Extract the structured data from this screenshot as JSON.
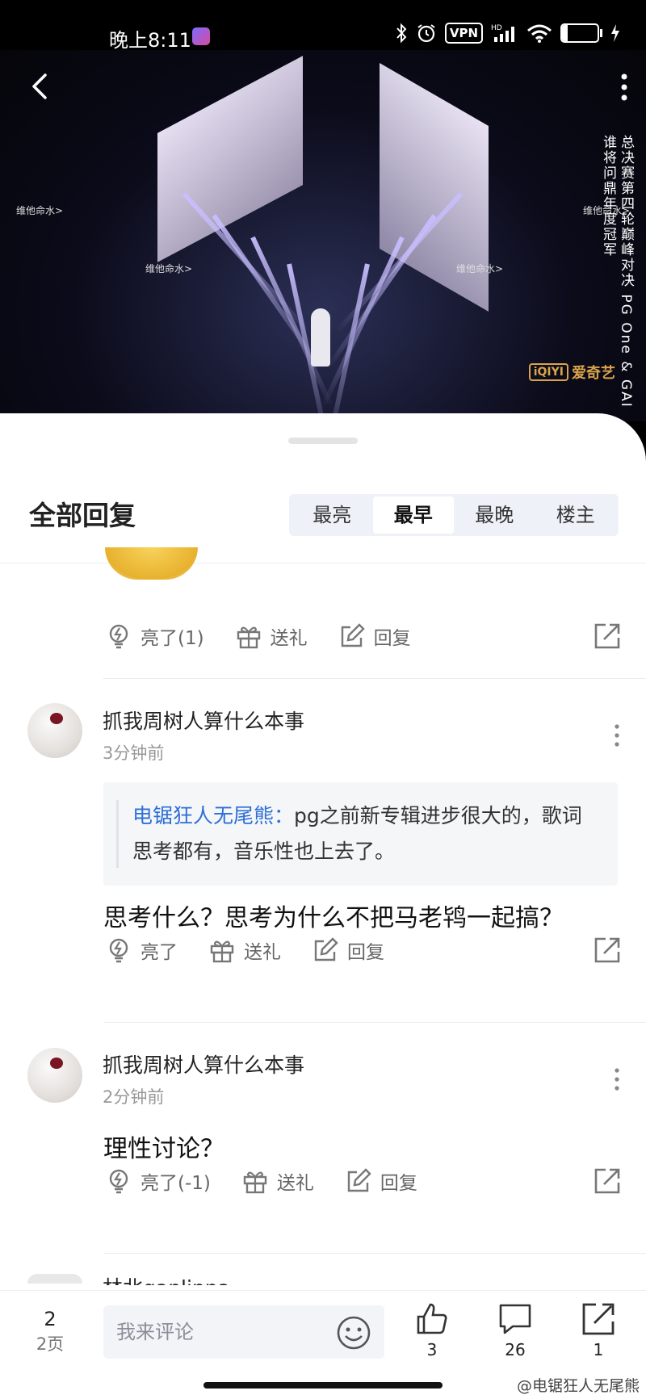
{
  "status_bar": {
    "time": "晚上8:11",
    "vpn": "VPN",
    "network": "HD",
    "battery": "17",
    "battery_level": 0.17
  },
  "video": {
    "overlay_title": "总决赛第四轮巅峰对决 PG One & GAI 谁将问鼎年度冠军",
    "captions": [
      "维他命水>",
      "维他命水>",
      "维他命水>",
      "维他命水>"
    ],
    "brand_badge": "iQIYI",
    "brand_name": "爱奇艺"
  },
  "sheet": {
    "title": "全部回复",
    "sort_tabs": [
      {
        "label": "最亮",
        "active": false
      },
      {
        "label": "最早",
        "active": true
      },
      {
        "label": "最晚",
        "active": false
      },
      {
        "label": "楼主",
        "active": false
      }
    ]
  },
  "top_actions": {
    "like": "亮了(1)",
    "gift": "送礼",
    "reply": "回复"
  },
  "comments": [
    {
      "username": "抓我周树人算什么本事",
      "time": "3分钟前",
      "quote_author": "电锯狂人无尾熊：",
      "quote_text": "pg之前新专辑进步很大的，歌词思考都有，音乐性也上去了。",
      "text": "思考什么？思考为什么不把马老鸨一起搞？",
      "like": "亮了",
      "gift": "送礼",
      "reply": "回复"
    },
    {
      "username": "抓我周树人算什么本事",
      "time": "2分钟前",
      "text": "理性讨论？",
      "like": "亮了(-1)",
      "gift": "送礼",
      "reply": "回复"
    }
  ],
  "partial_next_user": "林北ganlinna",
  "bottom_bar": {
    "page_current": "2",
    "page_total": "2页",
    "input_placeholder": "我来评论",
    "like_count": "3",
    "comment_count": "26",
    "share_count": "1"
  },
  "watermark": "@电锯狂人无尾熊",
  "colors": {
    "accent_blue": "#2d6fd8",
    "brand_gold": "#d9a44a"
  }
}
